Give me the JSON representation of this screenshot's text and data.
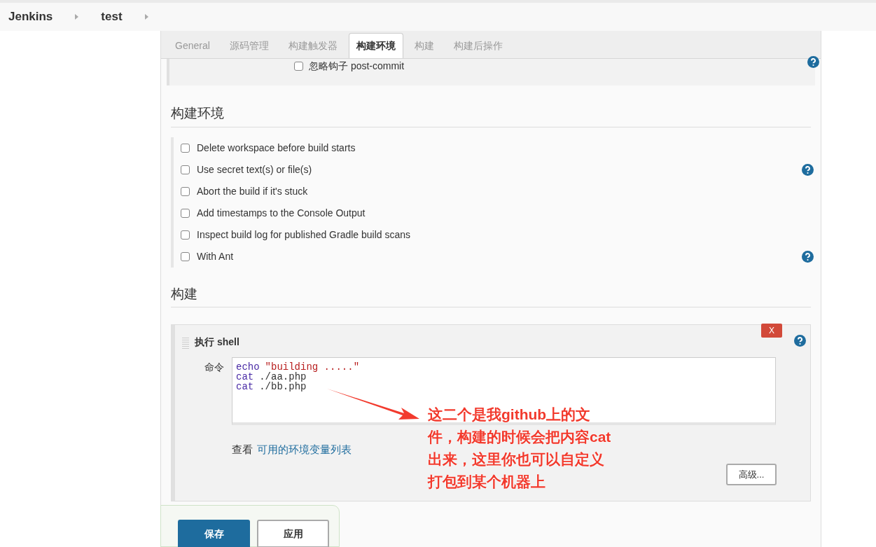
{
  "breadcrumbs": [
    "Jenkins",
    "test"
  ],
  "tabs": [
    {
      "label": "General",
      "selected": false
    },
    {
      "label": "源码管理",
      "selected": false
    },
    {
      "label": "构建触发器",
      "selected": false
    },
    {
      "label": "构建环境",
      "selected": true
    },
    {
      "label": "构建",
      "selected": false
    },
    {
      "label": "构建后操作",
      "selected": false
    }
  ],
  "trigger_option": {
    "label": "忽略钩子 post-commit",
    "checked": false
  },
  "build_env": {
    "title": "构建环境",
    "options": [
      {
        "label": "Delete workspace before build starts",
        "checked": false,
        "help": false
      },
      {
        "label": "Use secret text(s) or file(s)",
        "checked": false,
        "help": true
      },
      {
        "label": "Abort the build if it's stuck",
        "checked": false,
        "help": false
      },
      {
        "label": "Add timestamps to the Console Output",
        "checked": false,
        "help": false
      },
      {
        "label": "Inspect build log for published Gradle build scans",
        "checked": false,
        "help": false
      },
      {
        "label": "With Ant",
        "checked": false,
        "help": true
      }
    ]
  },
  "build": {
    "title": "构建",
    "step": {
      "title": "执行 shell",
      "delete": "X",
      "command_label": "命令",
      "command_lines": [
        {
          "keyword": "echo",
          "rest": "\"building .....\""
        },
        {
          "keyword": "cat",
          "rest": "./aa.php"
        },
        {
          "keyword": "cat",
          "rest": "./bb.php"
        }
      ],
      "env_text": "查看",
      "env_link": "可用的环境变量列表",
      "advanced": "高级..."
    }
  },
  "annotation": {
    "lines": [
      "这二个是我github上的文",
      "件，构建的时候会把内容cat",
      "出来，这里你也可以自定义",
      "打包到某个机器上"
    ]
  },
  "buttons": [
    {
      "label": "保存",
      "kind": "primary"
    },
    {
      "label": "应用",
      "kind": "secondary"
    }
  ]
}
